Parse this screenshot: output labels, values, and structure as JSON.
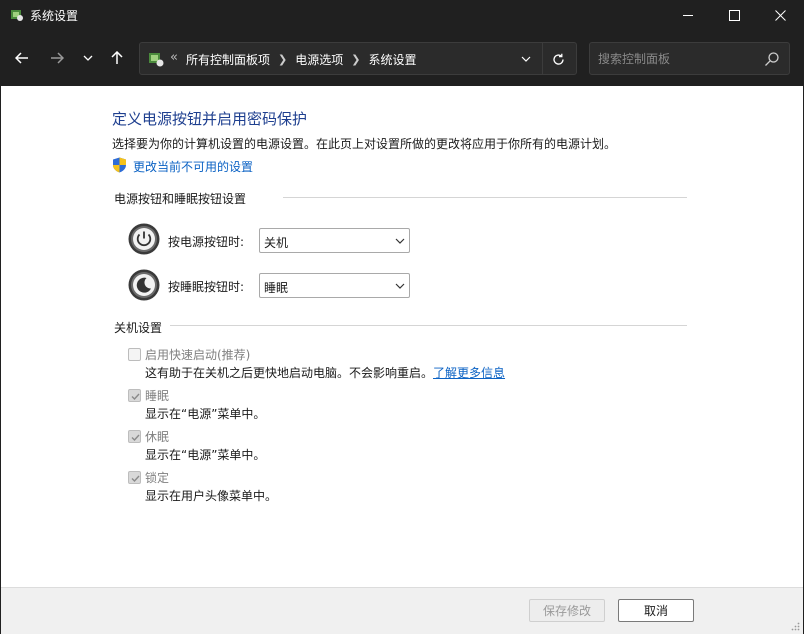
{
  "window": {
    "title": "系统设置"
  },
  "address": {
    "crumbs": [
      "所有控制面板项",
      "电源选项",
      "系统设置"
    ]
  },
  "search": {
    "placeholder": "搜索控制面板"
  },
  "main": {
    "title": "定义电源按钮并启用密码保护",
    "description": "选择要为你的计算机设置的电源设置。在此页上对设置所做的更改将应用于你所有的电源计划。",
    "change_link": "更改当前不可用的设置"
  },
  "power_section": {
    "heading": "电源按钮和睡眠按钮设置",
    "rows": [
      {
        "label": "按电源按钮时:",
        "value": "关机",
        "icon": "power-icon"
      },
      {
        "label": "按睡眠按钮时:",
        "value": "睡眠",
        "icon": "sleep-icon"
      }
    ]
  },
  "shutdown_section": {
    "heading": "关机设置",
    "items": [
      {
        "label": "启用快速启动(推荐)",
        "checked": false,
        "desc": "这有助于在关机之后更快地启动电脑。不会影响重启。",
        "link": "了解更多信息"
      },
      {
        "label": "睡眠",
        "checked": true,
        "desc": "显示在“电源”菜单中。"
      },
      {
        "label": "休眠",
        "checked": true,
        "desc": "显示在“电源”菜单中。"
      },
      {
        "label": "锁定",
        "checked": true,
        "desc": "显示在用户头像菜单中。"
      }
    ]
  },
  "footer": {
    "save_label": "保存修改",
    "cancel_label": "取消"
  },
  "colors": {
    "accent": "#0b62c4",
    "title_blue": "#1e3f8f",
    "chrome": "#202020"
  }
}
